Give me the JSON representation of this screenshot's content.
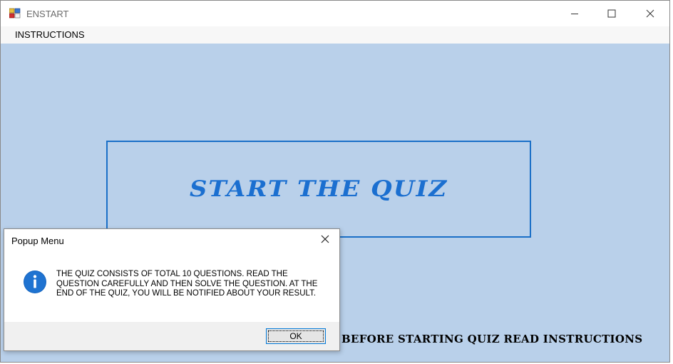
{
  "window": {
    "title": "ENSTART",
    "icon": "app-window-icon",
    "controls": {
      "minimize": "minimize-icon",
      "maximize": "maximize-icon",
      "close": "close-icon"
    }
  },
  "menubar": {
    "items": [
      {
        "label": "INSTRUCTIONS"
      }
    ]
  },
  "main": {
    "start_button_label": "START THE QUIZ",
    "instructions_note": "BEFORE STARTING QUIZ READ INSTRUCTIONS"
  },
  "dialog": {
    "title": "Popup Menu",
    "icon": "info-icon",
    "message": "THE QUIZ CONSISTS OF TOTAL 10 QUESTIONS. READ THE QUESTION CAREFULLY AND THEN SOLVE THE QUESTION. AT THE END OF THE QUIZ, YOU WILL BE NOTIFIED ABOUT YOUR RESULT.",
    "ok_label": "OK"
  },
  "colors": {
    "client_background": "#b9d0ea",
    "accent_blue": "#1b6fd0",
    "dialog_footer": "#f0f0f0"
  }
}
